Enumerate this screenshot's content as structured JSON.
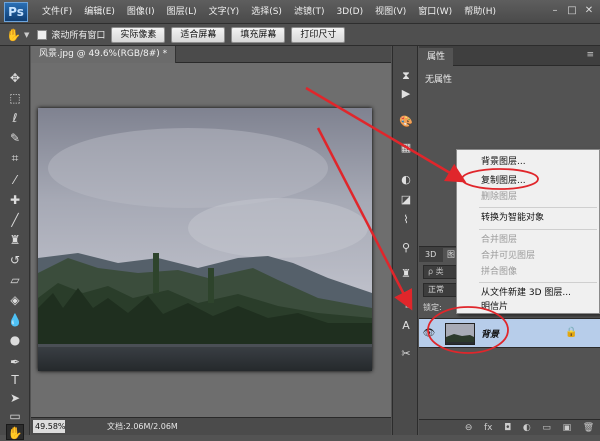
{
  "app": {
    "logo": "Ps"
  },
  "menu": [
    "文件(F)",
    "编辑(E)",
    "图像(I)",
    "图层(L)",
    "文字(Y)",
    "选择(S)",
    "滤镜(T)",
    "3D(D)",
    "视图(V)",
    "窗口(W)",
    "帮助(H)"
  ],
  "window_controls": {
    "minimize": "–",
    "maximize": "□",
    "close": "✕"
  },
  "options_bar": {
    "scroll_all_label": "滚动所有窗口",
    "buttons": [
      "实际像素",
      "适合屏幕",
      "填充屏幕",
      "打印尺寸"
    ]
  },
  "document": {
    "tab_title": "风景.jpg @ 49.6%(RGB/8#) *",
    "zoom": "49.58%",
    "info": "文档:2.06M/2.06M"
  },
  "properties": {
    "tab": "属性",
    "empty_text": "无属性"
  },
  "layers": {
    "tabs": [
      "3D",
      "图"
    ],
    "kind_filter": "ρ 类",
    "blend_mode": "正常",
    "lock_label": "锁定:",
    "layer_name": "背景"
  },
  "context_menu": {
    "items": [
      {
        "label": "背景图层...",
        "enabled": true
      },
      {
        "label": "复制图层...",
        "enabled": true,
        "highlighted": true
      },
      {
        "label": "删除图层",
        "enabled": false
      },
      {
        "label": "转换为智能对象",
        "enabled": true
      },
      {
        "label": "合并图层",
        "enabled": false
      },
      {
        "label": "合并可见图层",
        "enabled": false
      },
      {
        "label": "拼合图像",
        "enabled": false
      },
      {
        "label": "从文件新建 3D 图层...",
        "enabled": true
      },
      {
        "label": "明信片",
        "enabled": true
      }
    ]
  },
  "colors": {
    "annotation": "#e0262b",
    "layer_selected": "#b7cdea",
    "ui_dark": "#535353"
  }
}
